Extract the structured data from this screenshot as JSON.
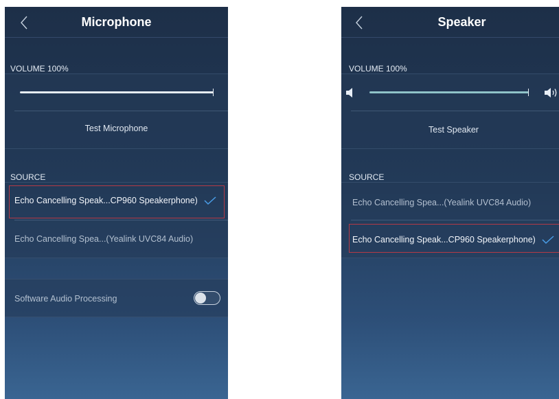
{
  "microphone": {
    "title": "Microphone",
    "volume_label": "VOLUME 100%",
    "volume_percent": 100,
    "test_button": "Test Microphone",
    "source_label": "SOURCE",
    "sources": [
      {
        "label": "Echo Cancelling Speak...CP960 Speakerphone)",
        "selected": true
      },
      {
        "label": "Echo Cancelling Spea...(Yealink UVC84 Audio)",
        "selected": false
      }
    ],
    "software_audio_processing": {
      "label": "Software Audio Processing",
      "enabled": false
    }
  },
  "speaker": {
    "title": "Speaker",
    "volume_label": "VOLUME 100%",
    "volume_percent": 100,
    "test_button": "Test Speaker",
    "source_label": "SOURCE",
    "sources": [
      {
        "label": "Echo Cancelling Spea...(Yealink UVC84 Audio)",
        "selected": false
      },
      {
        "label": "Echo Cancelling Speak...CP960 Speakerphone)",
        "selected": true
      }
    ]
  },
  "colors": {
    "accent_blue": "#4a9ee8",
    "selection_border": "#b53a46",
    "panel_top": "#1d2f48",
    "panel_bottom": "#3a6592",
    "speaker_track": "#8fc3c8"
  },
  "icons": {
    "back": "chevron-left-icon",
    "check": "check-icon",
    "volume_low": "volume-low-icon",
    "volume_high": "volume-high-icon"
  }
}
